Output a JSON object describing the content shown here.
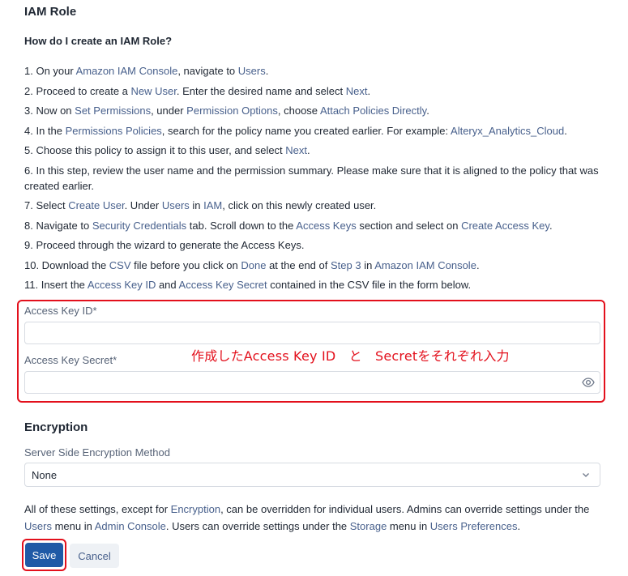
{
  "header": {
    "title": "IAM Role",
    "subtitle": "How do I create an IAM Role?"
  },
  "steps": [
    [
      "1. On your ",
      {
        "h": "Amazon IAM Console"
      },
      ", navigate to ",
      {
        "h": "Users"
      },
      "."
    ],
    [
      "2. Proceed to create a ",
      {
        "h": "New User"
      },
      ". Enter the desired name and select ",
      {
        "h": "Next"
      },
      "."
    ],
    [
      "3. Now on ",
      {
        "h": "Set Permissions"
      },
      ", under ",
      {
        "h": "Permission Options"
      },
      ", choose ",
      {
        "h": "Attach Policies Directly"
      },
      "."
    ],
    [
      "4. In the ",
      {
        "h": "Permissions Policies"
      },
      ", search for the policy name you created earlier. For example: ",
      {
        "h": "Alteryx_Analytics_Cloud"
      },
      "."
    ],
    [
      "5. Choose this policy to assign it to this user, and select ",
      {
        "h": "Next"
      },
      "."
    ],
    [
      "6. In this step, review the user name and the permission summary. Please make sure that it is aligned to the policy that was created earlier."
    ],
    [
      "7. Select ",
      {
        "h": "Create User"
      },
      ". Under ",
      {
        "h": "Users"
      },
      " in ",
      {
        "h": "IAM"
      },
      ", click on this newly created user."
    ],
    [
      "8. Navigate to ",
      {
        "h": "Security Credentials"
      },
      " tab. Scroll down to the ",
      {
        "h": "Access Keys"
      },
      " section and select on ",
      {
        "h": "Create Access Key"
      },
      "."
    ],
    [
      "9. Proceed through the wizard to generate the Access Keys."
    ],
    [
      "10. Download the ",
      {
        "h": "CSV"
      },
      " file before you click on ",
      {
        "h": "Done"
      },
      " at the end of ",
      {
        "h": "Step 3"
      },
      " in ",
      {
        "h": "Amazon IAM Console"
      },
      "."
    ],
    [
      "11. Insert the ",
      {
        "h": "Access Key ID"
      },
      " and ",
      {
        "h": "Access Key Secret"
      },
      " contained in the CSV file in the form below."
    ]
  ],
  "form": {
    "access_key_id_label": "Access Key ID*",
    "access_key_id_value": "",
    "access_key_secret_label": "Access Key Secret*",
    "access_key_secret_value": ""
  },
  "annotation": "作成したAccess Key ID　と　Secretをそれぞれ入力",
  "encryption": {
    "title": "Encryption",
    "method_label": "Server Side Encryption Method",
    "method_value": "None"
  },
  "note": [
    "All of these settings, except for ",
    {
      "h": "Encryption"
    },
    ", can be overridden for individual users. Admins can override settings under the ",
    {
      "h": "Users"
    },
    " menu in ",
    {
      "h": "Admin Console"
    },
    ". Users can override settings under the ",
    {
      "h": "Storage"
    },
    " menu in ",
    {
      "h": "Users Preferences"
    },
    "."
  ],
  "buttons": {
    "save": "Save",
    "cancel": "Cancel"
  },
  "colors": {
    "accent": "#1f5aa6",
    "highlight": "#e3101c",
    "link": "#48608c"
  },
  "icons": {
    "eye": "eye-icon",
    "chevron": "chevron-down-icon"
  }
}
